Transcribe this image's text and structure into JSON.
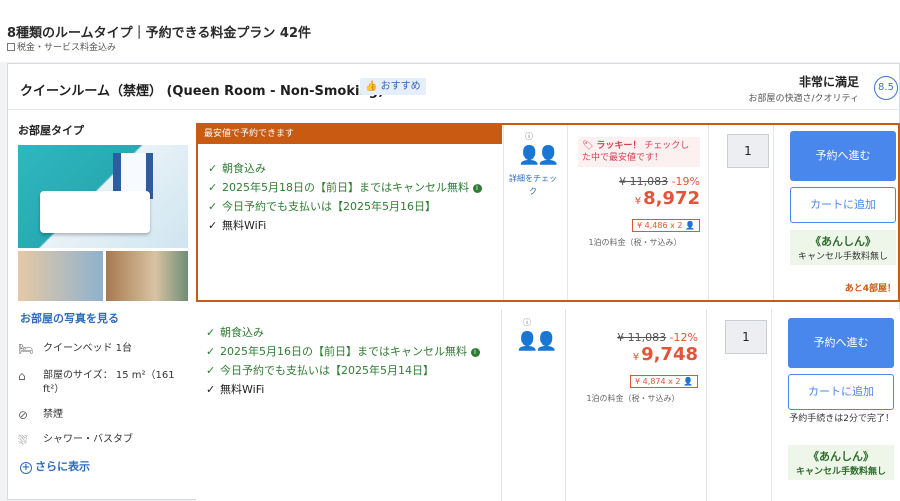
{
  "header": {
    "title": "8種類のルームタイプ｜予約できる料金プラン 42件",
    "subtitle": "税金・サービス料金込み"
  },
  "room": {
    "name": "クイーンルーム（禁煙） (Queen Room - Non-Smoking)",
    "recommend": "おすすめ",
    "rating_label": "非常に満足",
    "rating_sub": "お部屋の快適さ/クオリティ",
    "score": "8.5",
    "type_label": "お部屋タイプ",
    "see_photos": "お部屋の写真を見る",
    "amenities": [
      {
        "icon": "bed-icon",
        "label": "クイーンベッド 1台"
      },
      {
        "icon": "room-size-icon",
        "label": "部屋のサイズ： 15 m²（161 ft²）"
      },
      {
        "icon": "no-smoking-icon",
        "label": "禁煙"
      },
      {
        "icon": "shower-icon",
        "label": "シャワー・バスタブ"
      }
    ],
    "show_more": "さらに表示"
  },
  "plans": [
    {
      "banner": "最安値で予約できます",
      "conditions": [
        {
          "text": "朝食込み",
          "info": false,
          "plain": false
        },
        {
          "text": "2025年5月18日の【前日】まではキャンセル無料",
          "info": true,
          "plain": false
        },
        {
          "text": "今日予約でも支払いは【2025年5月16日】",
          "info": false,
          "plain": false
        },
        {
          "text": "無料WiFi",
          "info": false,
          "plain": true
        }
      ],
      "detail_link": "詳細をチェック",
      "lucky_bold": "ラッキー！",
      "lucky_text": "チェックした中で最安値です！",
      "old_price": "¥ 11,083",
      "discount": "-19%",
      "currency": "¥",
      "price": "8,972",
      "per_person": "¥ 4,486 x 2",
      "night_note": "1泊の料金（税・サ込み）",
      "quantity": "1",
      "book_label": "予約へ進む",
      "cart_label": "カートに追加",
      "anshin_title": "《あんしん》",
      "anshin_sub": "キャンセル手数料無し",
      "remaining": "あと4部屋！"
    },
    {
      "conditions": [
        {
          "text": "朝食込み",
          "info": false,
          "plain": false
        },
        {
          "text": "2025年5月16日の【前日】まではキャンセル無料",
          "info": true,
          "plain": false
        },
        {
          "text": "今日予約でも支払いは【2025年5月14日】",
          "info": false,
          "plain": false
        },
        {
          "text": "無料WiFi",
          "info": false,
          "plain": true
        }
      ],
      "old_price": "¥ 11,083",
      "discount": "-12%",
      "currency": "¥",
      "price": "9,748",
      "per_person": "¥ 4,874 x 2",
      "night_note": "1泊の料金（税・サ込み）",
      "quantity": "1",
      "book_label": "予約へ進む",
      "cart_label": "カートに追加",
      "quick_note": "予約手続きは2分で完了！",
      "anshin_title": "《あんしん》",
      "anshin_sub": "キャンセル手数料無し"
    }
  ]
}
